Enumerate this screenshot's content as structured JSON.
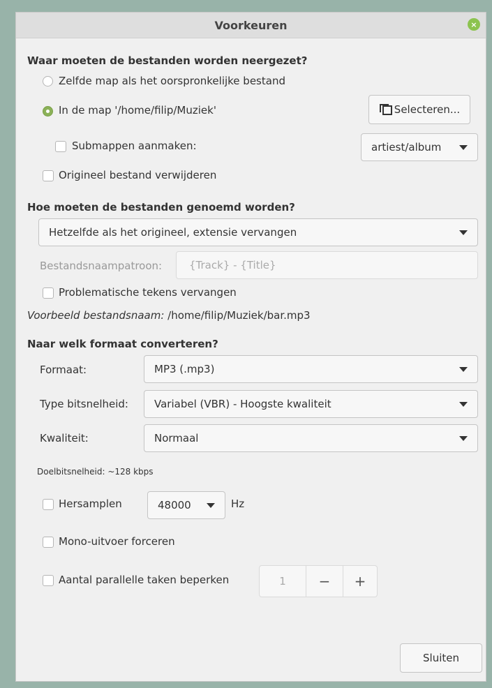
{
  "window": {
    "title": "Voorkeuren",
    "close_icon": "×"
  },
  "location": {
    "heading": "Waar moeten de bestanden worden neergezet?",
    "same_folder_label": "Zelfde map als het oorspronkelijke bestand",
    "in_folder_label": "In de map '/home/filip/Muziek'",
    "select_button": "Selecteren...",
    "subfolders_label": "Submappen aanmaken:",
    "subfolders_value": "artiest/album",
    "delete_original_label": "Origineel bestand verwijderen"
  },
  "naming": {
    "heading": "Hoe moeten de bestanden genoemd worden?",
    "mode_value": "Hetzelfde als het origineel, extensie vervangen",
    "pattern_label": "Bestandsnaampatroon:",
    "pattern_value": "{Track} - {Title}",
    "replace_chars_label": "Problematische tekens vervangen",
    "example_label": "Voorbeeld bestandsnaam:",
    "example_value": "/home/filip/Muziek/bar.mp3"
  },
  "format": {
    "heading": "Naar welk formaat converteren?",
    "format_label": "Formaat:",
    "format_value": "MP3 (.mp3)",
    "bitrate_type_label": "Type bitsnelheid:",
    "bitrate_type_value": "Variabel (VBR) - Hoogste kwaliteit",
    "quality_label": "Kwaliteit:",
    "quality_value": "Normaal",
    "target_bitrate": "Doelbitsnelheid: ~128 kbps",
    "resample_label": "Hersamplen",
    "resample_value": "48000",
    "resample_unit": "Hz",
    "mono_label": "Mono-uitvoer forceren",
    "parallel_label": "Aantal parallelle taken beperken",
    "parallel_value": "1",
    "minus": "−",
    "plus": "+"
  },
  "footer": {
    "close_button": "Sluiten"
  },
  "colors": {
    "accent": "#8bb158",
    "background": "#98b3a9"
  }
}
